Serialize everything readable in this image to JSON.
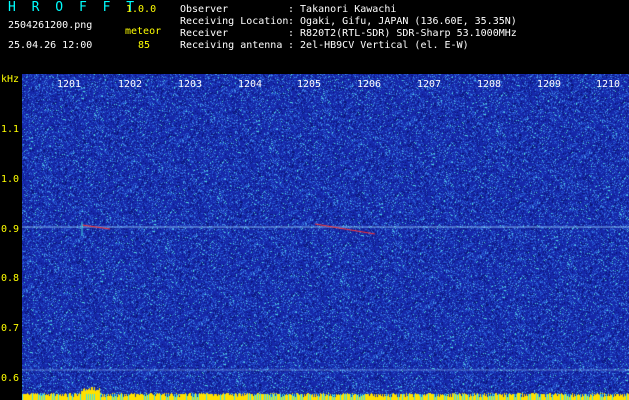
{
  "header": {
    "app_title": "H R O F F T",
    "app_version": "1.0.0",
    "file_name": "2504261200.png",
    "mode_label": "meteor",
    "date_time": "25.04.26 12:00",
    "count_value": "85",
    "info": [
      {
        "label": "Observer",
        "value": ": Takanori Kawachi"
      },
      {
        "label": "Receiving Location",
        "value": ": Ogaki, Gifu, JAPAN (136.60E, 35.35N)"
      },
      {
        "label": "Receiver",
        "value": ": R820T2(RTL-SDR) SDR-Sharp 53.1000MHz"
      },
      {
        "label": "Receiving antenna",
        "value": ": 2el-HB9CV Vertical (el. E-W)"
      }
    ]
  },
  "spectrogram": {
    "unit_label": "kHz",
    "freq_ticks": [
      "1.1",
      "1.0",
      "0.9",
      "0.8",
      "0.7",
      "0.6"
    ],
    "time_ticks": [
      "1201",
      "1202",
      "1203",
      "1204",
      "1205",
      "1206",
      "1207",
      "1208",
      "1209",
      "1210"
    ],
    "colors": {
      "background": "#1a2fb0",
      "noise_light": "#4a8fe0",
      "noise_cyan": "#40e0e0",
      "echo": "#ff3030",
      "level_bar": "#ffe000",
      "trace": "#9fd8ff"
    }
  }
}
